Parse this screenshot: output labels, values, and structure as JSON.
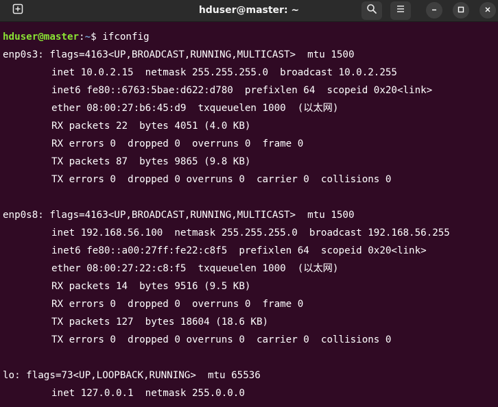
{
  "window": {
    "title": "hduser@master: ~"
  },
  "icons": {
    "new_tab": "new-tab-icon",
    "search": "search-icon",
    "menu": "hamburger-menu-icon",
    "minimize": "minimize-icon",
    "maximize": "maximize-icon",
    "close": "close-icon"
  },
  "colors": {
    "background": "#300a24",
    "titlebar": "#2b2b2b",
    "prompt_user": "#8ae234",
    "prompt_path": "#729fcf",
    "text": "#ffffff"
  },
  "prompt": {
    "user_host": "hduser@master",
    "colon": ":",
    "path": "~",
    "symbol": "$ ",
    "command": "ifconfig"
  },
  "output": {
    "enp0s3": {
      "header": "enp0s3: flags=4163<UP,BROADCAST,RUNNING,MULTICAST>  mtu 1500",
      "inet": "inet 10.0.2.15  netmask 255.255.255.0  broadcast 10.0.2.255",
      "inet6": "inet6 fe80::6763:5bae:d622:d780  prefixlen 64  scopeid 0x20<link>",
      "ether": "ether 08:00:27:b6:45:d9  txqueuelen 1000  (以太网)",
      "rx_packets": "RX packets 22  bytes 4051 (4.0 KB)",
      "rx_errors": "RX errors 0  dropped 0  overruns 0  frame 0",
      "tx_packets": "TX packets 87  bytes 9865 (9.8 KB)",
      "tx_errors": "TX errors 0  dropped 0 overruns 0  carrier 0  collisions 0"
    },
    "enp0s8": {
      "header": "enp0s8: flags=4163<UP,BROADCAST,RUNNING,MULTICAST>  mtu 1500",
      "inet": "inet 192.168.56.100  netmask 255.255.255.0  broadcast 192.168.56.255",
      "inet6": "inet6 fe80::a00:27ff:fe22:c8f5  prefixlen 64  scopeid 0x20<link>",
      "ether": "ether 08:00:27:22:c8:f5  txqueuelen 1000  (以太网)",
      "rx_packets": "RX packets 14  bytes 9516 (9.5 KB)",
      "rx_errors": "RX errors 0  dropped 0  overruns 0  frame 0",
      "tx_packets": "TX packets 127  bytes 18604 (18.6 KB)",
      "tx_errors": "TX errors 0  dropped 0 overruns 0  carrier 0  collisions 0"
    },
    "lo": {
      "header": "lo: flags=73<UP,LOOPBACK,RUNNING>  mtu 65536",
      "inet": "inet 127.0.0.1  netmask 255.0.0.0"
    }
  }
}
